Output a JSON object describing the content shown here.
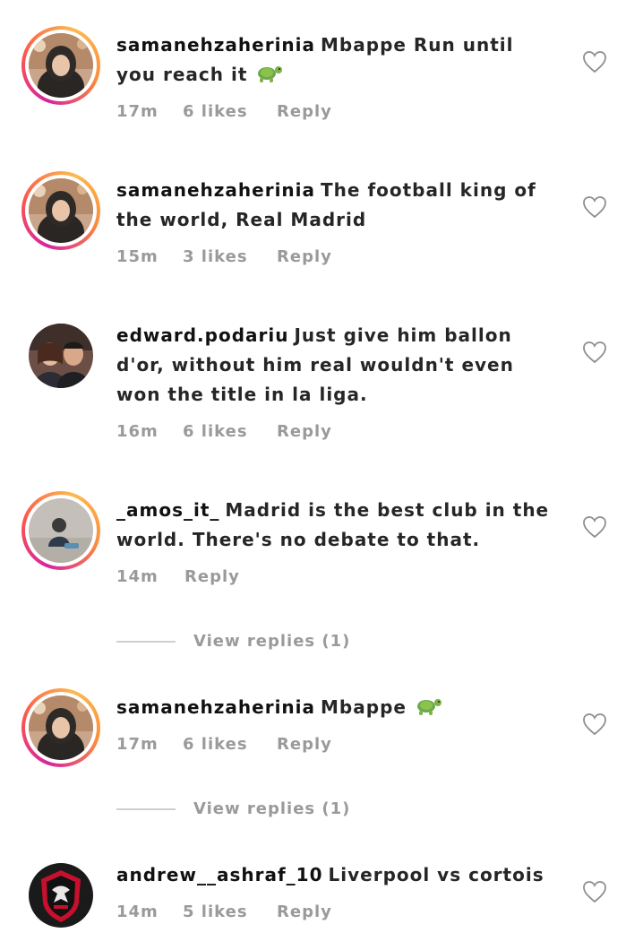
{
  "colors": {
    "text": "#262626",
    "meta": "#9a9a9a",
    "divider": "#cfcfcf",
    "story_ring_start": "#d6249f",
    "story_ring_end": "#fdb94f"
  },
  "comments": [
    {
      "username": "samanehzaherinia",
      "text": "Mbappe Run until you reach it",
      "emoji": "turtle-emoji",
      "time": "17m",
      "likes": "6 likes",
      "reply": "Reply",
      "avatar": "woman-hijab-avatar",
      "story_ring": true
    },
    {
      "username": "samanehzaherinia",
      "text": "The football king of the world, Real Madrid",
      "time": "15m",
      "likes": "3 likes",
      "reply": "Reply",
      "avatar": "woman-hijab-avatar",
      "story_ring": true
    },
    {
      "username": "edward.podariu",
      "text": "Just give him ballon d'or, without him real wouldn't even won the title in la liga.",
      "time": "16m",
      "likes": "6 likes",
      "reply": "Reply",
      "avatar": "couple-avatar",
      "story_ring": false
    },
    {
      "username": "_amos_it_",
      "text": "Madrid is the best club in the world. There's no debate to that.",
      "time": "14m",
      "reply": "Reply",
      "avatar": "person-floor-avatar",
      "story_ring": true,
      "view_replies": "View replies (1)"
    },
    {
      "username": "samanehzaherinia",
      "text": "Mbappe",
      "emoji": "turtle-emoji",
      "time": "17m",
      "likes": "6 likes",
      "reply": "Reply",
      "avatar": "woman-hijab-avatar",
      "story_ring": true,
      "view_replies": "View replies (1)"
    },
    {
      "username": "andrew__ashraf_10",
      "text": "Liverpool vs cortois",
      "time": "14m",
      "likes": "5 likes",
      "reply": "Reply",
      "avatar": "al-ahly-logo-avatar",
      "story_ring": false
    }
  ]
}
